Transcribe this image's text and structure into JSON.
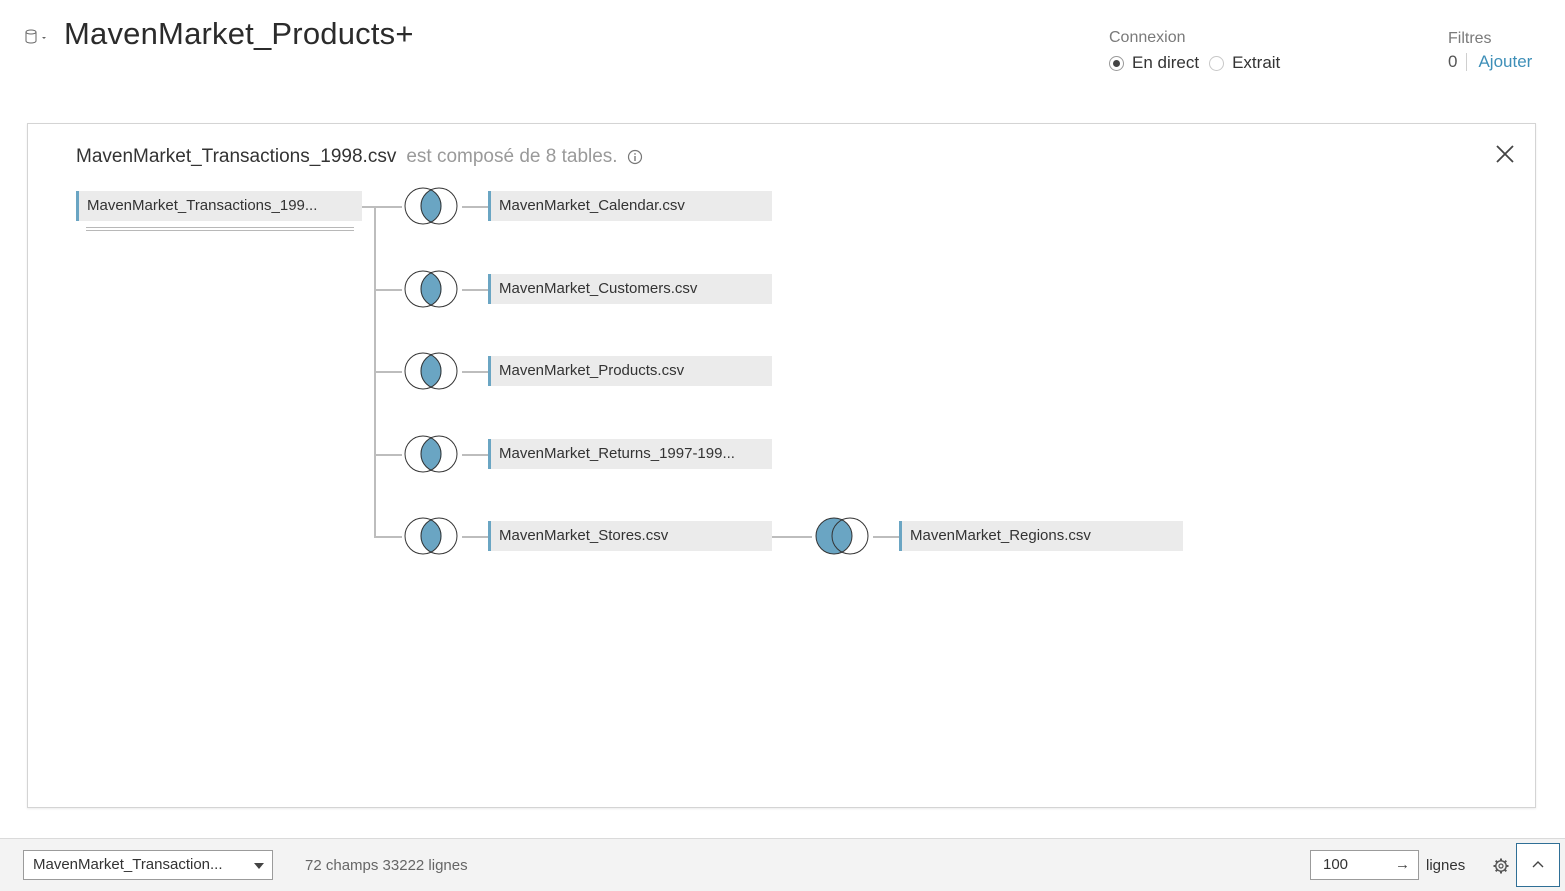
{
  "header": {
    "title": "MavenMarket_Products+",
    "connection_label": "Connexion",
    "connection_options": [
      {
        "label": "En direct",
        "selected": true
      },
      {
        "label": "Extrait",
        "selected": false
      }
    ],
    "filters_label": "Filtres",
    "filters_count": "0",
    "filters_add": "Ajouter"
  },
  "panel": {
    "table_name": "MavenMarket_Transactions_1998.csv",
    "description": "est composé de 8 tables.",
    "root_table": "MavenMarket_Transactions_199...",
    "joined_tables": [
      "MavenMarket_Calendar.csv",
      "MavenMarket_Customers.csv",
      "MavenMarket_Products.csv",
      "MavenMarket_Returns_1997-199...",
      "MavenMarket_Stores.csv"
    ],
    "secondary_table": "MavenMarket_Regions.csv"
  },
  "footer": {
    "selected_table": "MavenMarket_Transaction...",
    "stats": "72 champs 33222 lignes",
    "rows_value": "100",
    "rows_arrow": "→",
    "rows_label": "lignes"
  },
  "colors": {
    "accent": "#6aa5c3",
    "join_fill": "#6aa5c3",
    "link": "#3e8fb8"
  }
}
